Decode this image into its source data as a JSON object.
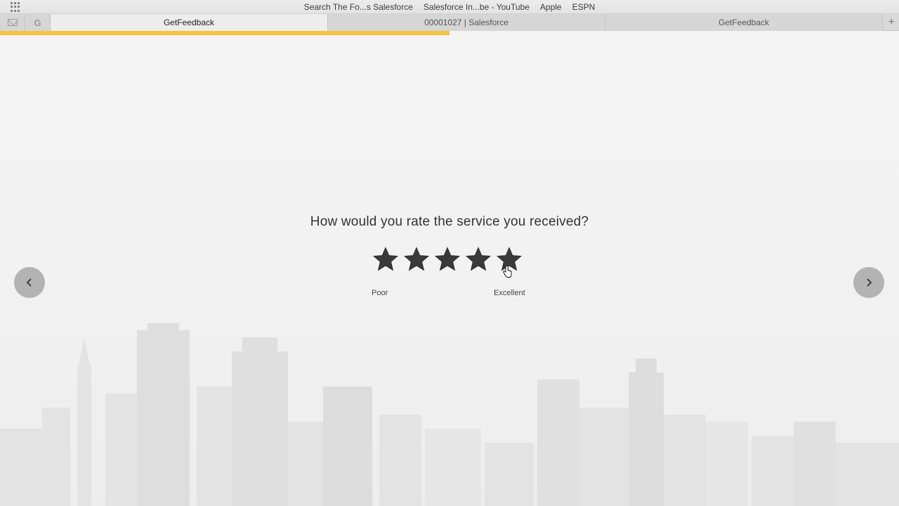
{
  "bookmarks": [
    "Search The Fo...s Salesforce",
    "Salesforce In...be - YouTube",
    "Apple",
    "ESPN"
  ],
  "tabs": [
    {
      "label": "GetFeedback",
      "active": true
    },
    {
      "label": "00001027 | Salesforce",
      "active": false
    },
    {
      "label": "GetFeedback",
      "active": false
    }
  ],
  "new_tab_label": "+",
  "progress": 0.5,
  "survey": {
    "question": "How would you rate the service you received?",
    "rating_max": 5,
    "label_low": "Poor",
    "label_high": "Excellent"
  },
  "colors": {
    "progress": "#f5c23c",
    "star": "#3a3a3a",
    "nav_button": "#b3b3b3"
  },
  "icons": {
    "apps": "apps-grid-icon",
    "gmail": "mail-icon",
    "google": "google-icon",
    "prev": "chevron-left-icon",
    "next": "chevron-right-icon",
    "star": "star-icon",
    "cursor": "hand-pointer-cursor-icon"
  }
}
